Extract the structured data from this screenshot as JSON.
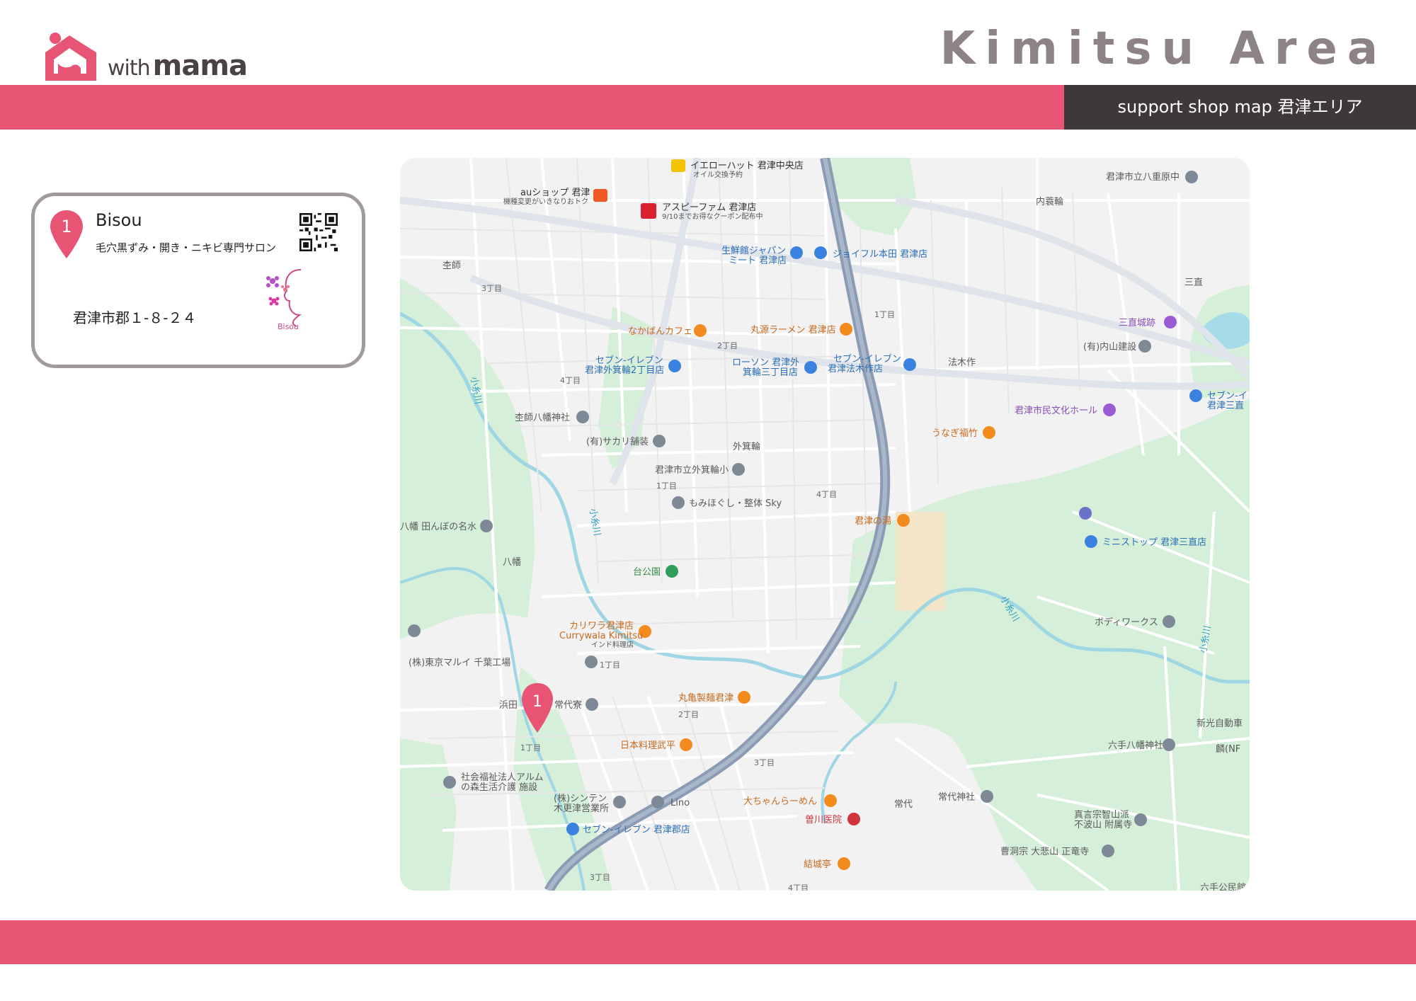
{
  "header": {
    "brand_small": "with",
    "brand_big": "mama",
    "area_title": "Kimitsu  Area",
    "subtitle": "support shop map  君津エリア"
  },
  "colors": {
    "accent": "#e85473",
    "dark": "#3f3839",
    "title_gray": "#8d8385"
  },
  "shop": {
    "number": "1",
    "name": "Bisou",
    "description": "毛穴黒ずみ・開き・ニキビ専門サロン",
    "address": "君津市郡１-８-２４",
    "logo_text": "Bisou",
    "icons": [
      "map-pin-icon",
      "qr-code-icon",
      "flower-face-logo-icon"
    ]
  },
  "map": {
    "marker_number": "1",
    "labels": {
      "yellowhat": "イエローハット 君津中央店",
      "yellowhat_sub": "オイル交換予約",
      "au": "auショップ 君津",
      "au_sub": "機種変更がいきなりおトク",
      "aspi": "アスピーファム 君津店",
      "aspi_sub": "9/10までお得なクーポン配布中",
      "seisen": "生鮮館ジャパン",
      "seisen2": "ミート 君津店",
      "joyful": "ジョイフル本田 君津店",
      "yaeharanaka": "君津市立八重原中",
      "uchiminowa": "内蓑輪",
      "kuushi": "杢師",
      "sanchoku": "三直",
      "sanchokujo": "三直城跡",
      "uchiyama": "(有)内山建設",
      "chome3a": "3丁目",
      "chome1a": "1丁目",
      "chome2a": "2丁目",
      "chome4a": "4丁目",
      "nakaban": "なかばんカフェ",
      "marugen": "丸源ラーメン 君津店",
      "seven1a": "セブン-イレブン",
      "seven1b": "君津外箕輪2丁目店",
      "lawson1": "ローソン 君津外",
      "lawson2": "箕輪三丁目店",
      "seven2a": "セブン-イレブン",
      "seven2b": "君津法木作店",
      "hokisaku": "法木作",
      "seven3a": "セブン-イ",
      "seven3b": "君津三直",
      "kuushi_hachiman": "杢師八幡神社",
      "bunka": "君津市民文化ホール",
      "sakari": "(有)サカリ舗装",
      "soto": "外箕輪",
      "unagi": "うなぎ福竹",
      "sotomino_sho": "君津市立外箕輪小",
      "chome1b": "1丁目",
      "momi": "もみほぐし・整体 Sky",
      "chome4b": "4丁目",
      "kimitsu_yu": "君津の湯",
      "hachiman_ta": "八幡 田んぼの名水",
      "ministop": "ミニストップ 君津三直店",
      "hachiman": "八幡",
      "river1": "小糸川",
      "river2": "小糸川",
      "river3": "小糸川",
      "river4": "小糸川",
      "daikoen": "台公園",
      "currywala1": "カリワラ君津店",
      "currywala2": "Currywala Kimitsu",
      "currywala3": "インド料理店",
      "body": "ボディワークス",
      "marui": "(株)東京マルイ 千葉工場",
      "chome1c": "1丁目",
      "hamada": "浜田",
      "tsunesho": "常代寮",
      "marugame": "丸亀製麺君津",
      "chome2b": "2丁目",
      "shinko": "新光自動車",
      "chome1d": "1丁目",
      "nihon": "日本料理武平",
      "rokute": "六手八幡神社",
      "rin": "麟(NF",
      "chome3b": "3丁目",
      "arum1": "社会福祉法人アルム",
      "arum2": "の森生活介護 施設",
      "shinten1": "(株)シンテン",
      "shinten2": "木更津営業所",
      "lino": "Lino",
      "taichan": "大ちゃんらーめん",
      "tsunesho2": "常代",
      "tsuneshiro": "常代神社",
      "sonegawa": "曽川医院",
      "shingon1": "真言宗智山派",
      "shingon2": "不波山 附属寺",
      "seven4": "セブン-イレブン 君津郡店",
      "yuki": "結城亭",
      "sotoshu": "曹洞宗 大悲山 正竜寺",
      "chome3c": "3丁目",
      "chome4c": "4丁目",
      "rokutepark": "六手公民館"
    }
  }
}
